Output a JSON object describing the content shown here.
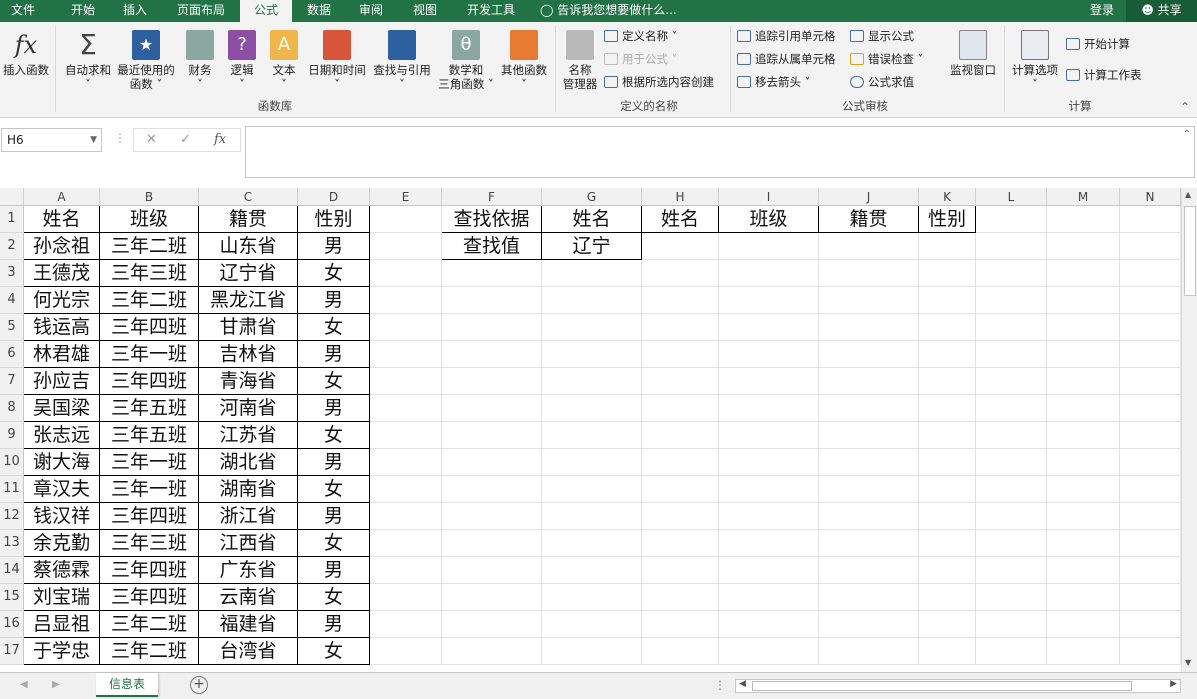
{
  "tabs": [
    "文件",
    "开始",
    "插入",
    "页面布局",
    "公式",
    "数据",
    "审阅",
    "视图",
    "开发工具"
  ],
  "active_tab": "公式",
  "tell_me": "告诉我您想要做什么...",
  "login": "登录",
  "share": "共享",
  "ribbon": {
    "insert_function": "插入函数",
    "autosum": "自动求和",
    "recent_1": "最近使用的",
    "recent_2": "函数",
    "financial": "财务",
    "logical": "逻辑",
    "text": "文本",
    "datetime": "日期和时间",
    "lookup": "查找与引用",
    "math_1": "数学和",
    "math_2": "三角函数",
    "more": "其他函数",
    "group_library": "函数库",
    "name_mgr_1": "名称",
    "name_mgr_2": "管理器",
    "define_name": "定义名称",
    "use_in_formula": "用于公式",
    "create_from_sel": "根据所选内容创建",
    "group_names": "定义的名称",
    "trace_precedents": "追踪引用单元格",
    "trace_dependents": "追踪从属单元格",
    "remove_arrows": "移去箭头",
    "show_formulas": "显示公式",
    "error_checking": "错误检查",
    "evaluate": "公式求值",
    "watch": "监视窗口",
    "group_audit": "公式审核",
    "calc_options": "计算选项",
    "calc_now": "开始计算",
    "calc_sheet": "计算工作表",
    "group_calc": "计算"
  },
  "namebox": "H6",
  "columns": [
    "A",
    "B",
    "C",
    "D",
    "E",
    "F",
    "G",
    "H",
    "I",
    "J",
    "K",
    "L",
    "M",
    "N"
  ],
  "rows": [
    "1",
    "2",
    "3",
    "4",
    "5",
    "6",
    "7",
    "8",
    "9",
    "10",
    "11",
    "12",
    "13",
    "14",
    "15",
    "16",
    "17"
  ],
  "table": [
    [
      "姓名",
      "班级",
      "籍贯",
      "性别"
    ],
    [
      "孙念祖",
      "三年二班",
      "山东省",
      "男"
    ],
    [
      "王德茂",
      "三年三班",
      "辽宁省",
      "女"
    ],
    [
      "何光宗",
      "三年二班",
      "黑龙江省",
      "男"
    ],
    [
      "钱运高",
      "三年四班",
      "甘肃省",
      "女"
    ],
    [
      "林君雄",
      "三年一班",
      "吉林省",
      "男"
    ],
    [
      "孙应吉",
      "三年四班",
      "青海省",
      "女"
    ],
    [
      "吴国梁",
      "三年五班",
      "河南省",
      "男"
    ],
    [
      "张志远",
      "三年五班",
      "江苏省",
      "女"
    ],
    [
      "谢大海",
      "三年一班",
      "湖北省",
      "男"
    ],
    [
      "章汉夫",
      "三年一班",
      "湖南省",
      "女"
    ],
    [
      "钱汉祥",
      "三年四班",
      "浙江省",
      "男"
    ],
    [
      "余克勤",
      "三年三班",
      "江西省",
      "女"
    ],
    [
      "蔡德霖",
      "三年四班",
      "广东省",
      "男"
    ],
    [
      "刘宝瑞",
      "三年四班",
      "云南省",
      "女"
    ],
    [
      "吕显祖",
      "三年二班",
      "福建省",
      "男"
    ],
    [
      "于学忠",
      "三年二班",
      "台湾省",
      "女"
    ]
  ],
  "lookup": {
    "f1": "查找依据",
    "g1": "姓名",
    "f2": "查找值",
    "g2": "辽宁"
  },
  "result_headers": [
    "姓名",
    "班级",
    "籍贯",
    "性别"
  ],
  "sheet_name": "信息表"
}
